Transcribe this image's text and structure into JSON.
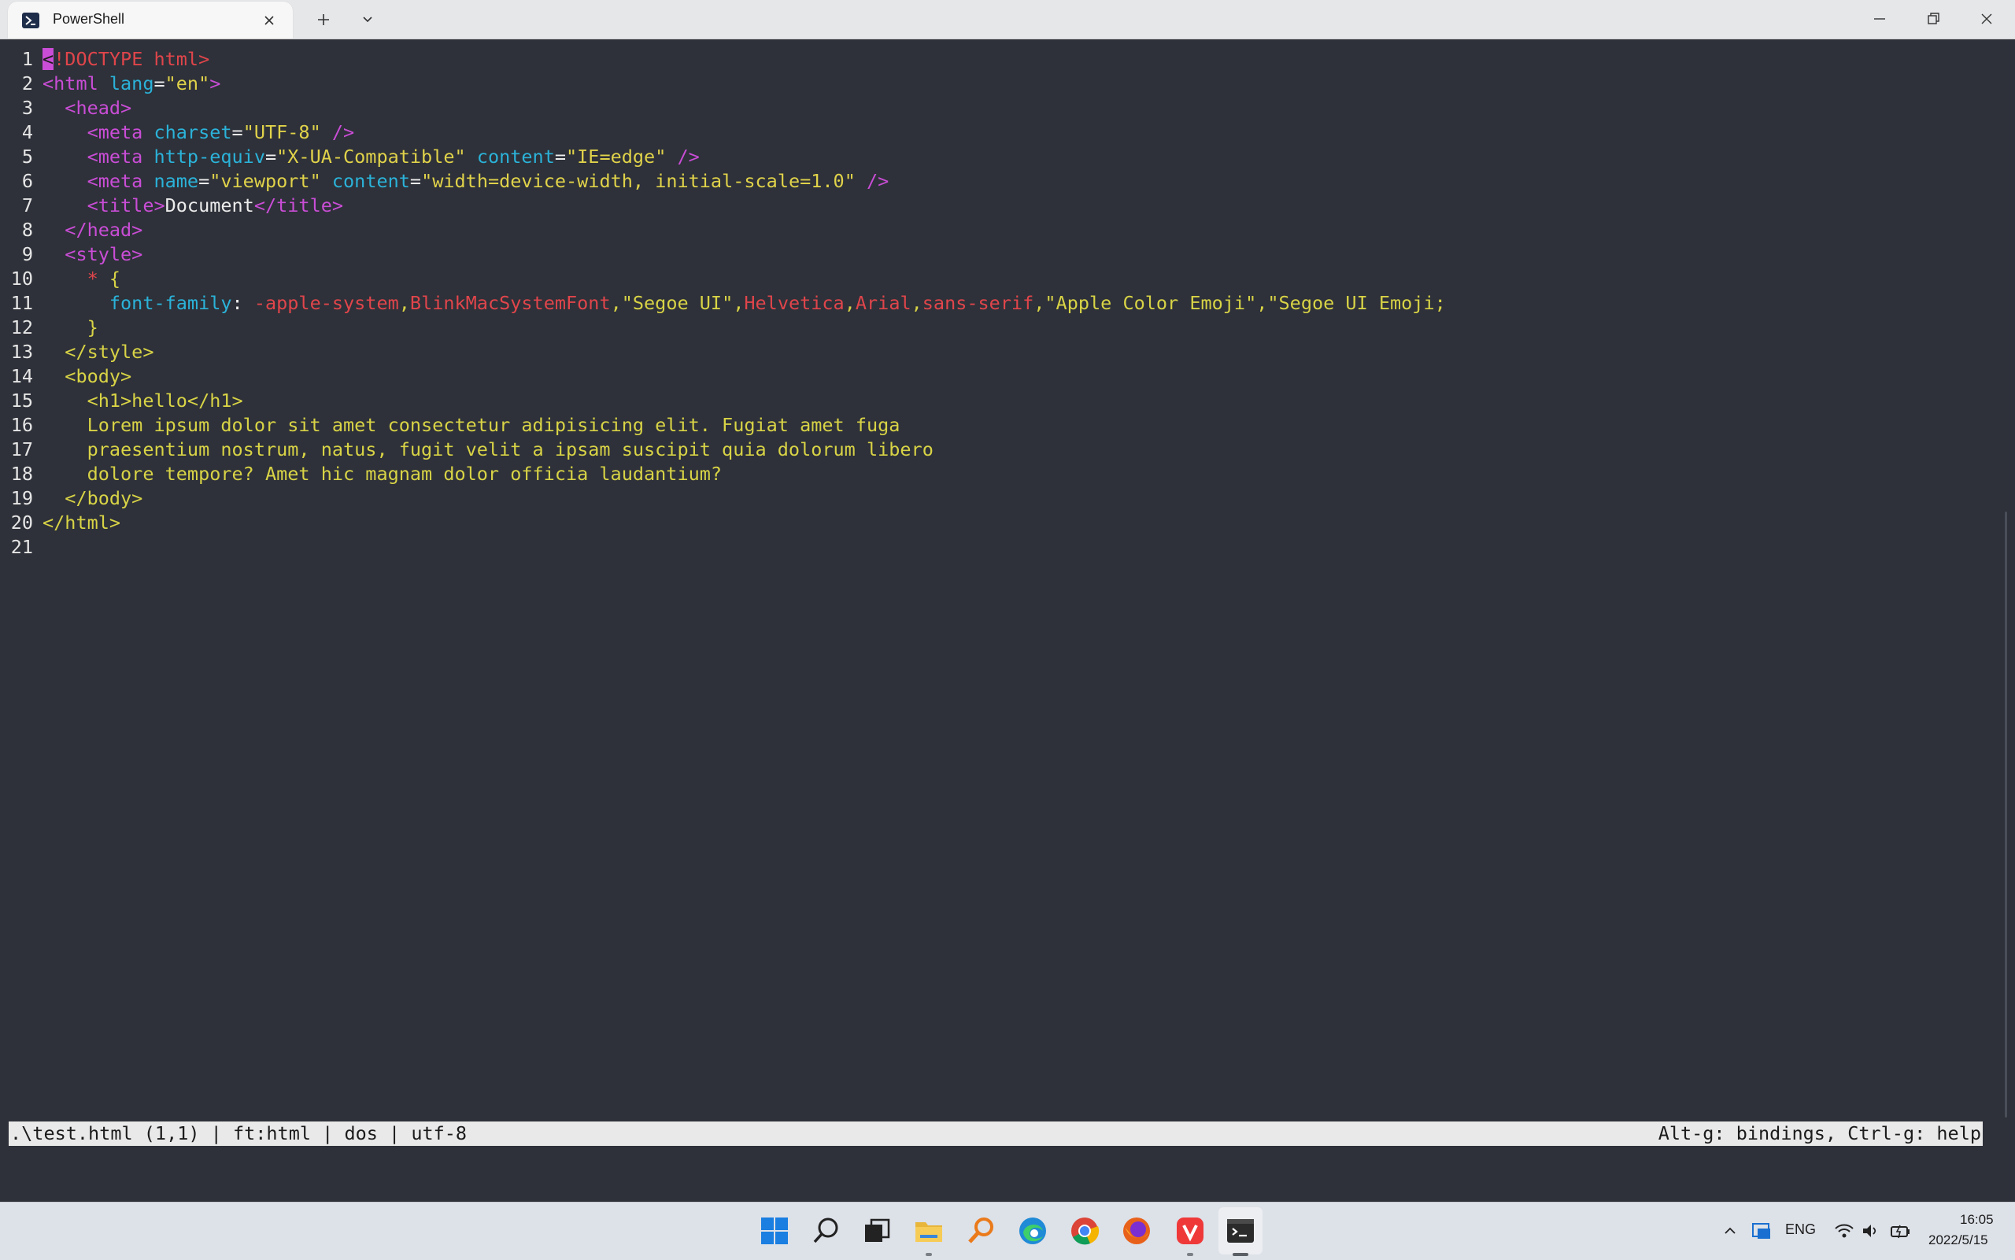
{
  "window": {
    "tab_title": "PowerShell",
    "new_tab_label": "+",
    "dropdown_label": "⌄"
  },
  "editor": {
    "lines": [
      {
        "n": "1"
      },
      {
        "n": "2"
      },
      {
        "n": "3"
      },
      {
        "n": "4"
      },
      {
        "n": "5"
      },
      {
        "n": "6"
      },
      {
        "n": "7"
      },
      {
        "n": "8"
      },
      {
        "n": "9"
      },
      {
        "n": "10"
      },
      {
        "n": "11"
      },
      {
        "n": "12"
      },
      {
        "n": "13"
      },
      {
        "n": "14"
      },
      {
        "n": "15"
      },
      {
        "n": "16"
      },
      {
        "n": "17"
      },
      {
        "n": "18"
      },
      {
        "n": "19"
      },
      {
        "n": "20"
      },
      {
        "n": "21"
      }
    ],
    "t": {
      "l1a": "<",
      "l1b": "!DOCTYPE html>",
      "l2a": "<html ",
      "l2b": "lang",
      "l2c": "=",
      "l2d": "\"en\"",
      "l2e": ">",
      "l3": "  <head>",
      "l4a": "    <meta ",
      "l4b": "charset",
      "l4c": "=",
      "l4d": "\"UTF-8\"",
      "l4e": " />",
      "l5a": "    <meta ",
      "l5b": "http-equiv",
      "l5c": "=",
      "l5d": "\"X-UA-Compatible\"",
      "l5e": " ",
      "l5f": "content",
      "l5g": "=",
      "l5h": "\"IE=edge\"",
      "l5i": " />",
      "l6a": "    <meta ",
      "l6b": "name",
      "l6c": "=",
      "l6d": "\"viewport\"",
      "l6e": " ",
      "l6f": "content",
      "l6g": "=",
      "l6h": "\"width=device-width, initial-scale=1.0\"",
      "l6i": " />",
      "l7a": "    <title>",
      "l7b": "Document",
      "l7c": "</title>",
      "l8": "  </head>",
      "l9": "  <style>",
      "l10a": "    * ",
      "l10b": "{",
      "l11a": "      font-family",
      "l11b": ": ",
      "l11c": "-apple-system",
      "l11d": ",",
      "l11e": "BlinkMacSystemFont",
      "l11f": ",\"Segoe UI\",",
      "l11g": "Helvetica",
      "l11h": ",",
      "l11i": "Arial",
      "l11j": ",",
      "l11k": "sans-serif",
      "l11l": ",\"Apple Color Emoji\",\"Segoe UI Emoji;",
      "l12": "    }",
      "l13": "  </style>",
      "l14": "  <body>",
      "l15": "    <h1>hello</h1>",
      "l16": "    Lorem ipsum dolor sit amet consectetur adipisicing elit. Fugiat amet fuga",
      "l17": "    praesentium nostrum, natus, fugit velit a ipsam suscipit quia dolorum libero",
      "l18": "    dolore tempore? Amet hic magnam dolor officia laudantium?",
      "l19": "  </body>",
      "l20": "</html>"
    }
  },
  "statusbar": {
    "left": ".\\test.html (1,1) | ft:html | dos | utf-8",
    "right": "Alt-g: bindings, Ctrl-g: help"
  },
  "taskbar": {
    "lang": "ENG",
    "time": "16:05",
    "date": "2022/5/15"
  },
  "colors": {
    "editor_bg": "#2e3139",
    "tag": "#c94dd6",
    "attr": "#2bb2d9",
    "string": "#e0d24a",
    "error_red": "#e0454b",
    "text_yellow": "#d8d346"
  },
  "icons": [
    "powershell-icon",
    "close-icon",
    "plus-icon",
    "chevron-down-icon",
    "minimize-icon",
    "maximize-icon",
    "window-close-icon",
    "windows-start-icon",
    "search-icon",
    "task-view-icon",
    "file-explorer-icon",
    "magnifier-app-icon",
    "edge-icon",
    "chrome-icon",
    "firefox-icon",
    "vivaldi-icon",
    "terminal-icon",
    "chevron-up-icon",
    "tray-app-icon",
    "wifi-icon",
    "volume-icon",
    "battery-icon"
  ]
}
